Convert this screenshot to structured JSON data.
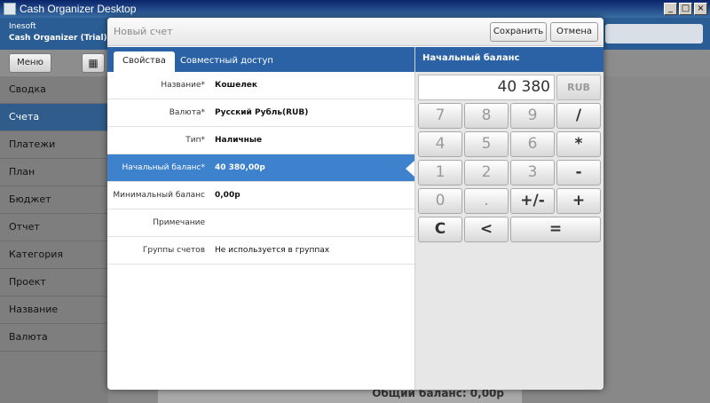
{
  "window": {
    "title": "Cash Organizer Desktop",
    "minimize": "_",
    "maximize": "□",
    "close": "×"
  },
  "app": {
    "vendor": "Inesoft",
    "product": "Cash Organizer (Trial)",
    "menu_label": "Меню",
    "calc_icon": "▦"
  },
  "sidebar": {
    "items": [
      {
        "label": "Сводка"
      },
      {
        "label": "Счета"
      },
      {
        "label": "Платежи"
      },
      {
        "label": "План"
      },
      {
        "label": "Бюджет"
      },
      {
        "label": "Отчет"
      },
      {
        "label": "Категория"
      },
      {
        "label": "Проект"
      },
      {
        "label": "Название"
      },
      {
        "label": "Валюта"
      }
    ],
    "active": "Счета"
  },
  "background": {
    "total_label": "Общий баланс: 0,00р"
  },
  "modal": {
    "title": "Новый счет",
    "save_label": "Сохранить",
    "cancel_label": "Отмена",
    "tabs": [
      {
        "label": "Свойства"
      },
      {
        "label": "Совместный доступ"
      }
    ],
    "active_tab": "Свойства",
    "fields": [
      {
        "label": "Название*",
        "value": "Кошелек"
      },
      {
        "label": "Валюта*",
        "value": "Русский Рубль(RUB)"
      },
      {
        "label": "Тип*",
        "value": "Наличные"
      },
      {
        "label": "Начальный баланс*",
        "value": "40 380,00р"
      },
      {
        "label": "Минимальный баланс",
        "value": "0,00р"
      },
      {
        "label": "Примечание",
        "value": ""
      },
      {
        "label": "Группы счетов",
        "value": "Не используется в группах"
      }
    ],
    "selected_field": "Начальный баланс*"
  },
  "calculator": {
    "title": "Начальный баланс",
    "display": "40 380",
    "currency": "RUB",
    "keys": [
      "7",
      "8",
      "9",
      "/",
      "4",
      "5",
      "6",
      "*",
      "1",
      "2",
      "3",
      "-",
      "0",
      ".",
      "+/-",
      "+",
      "C",
      "<",
      "="
    ]
  },
  "colors": {
    "accent": "#2b62a6",
    "selected": "#3e81cc",
    "sidebar_active": "#2f5c8a"
  }
}
